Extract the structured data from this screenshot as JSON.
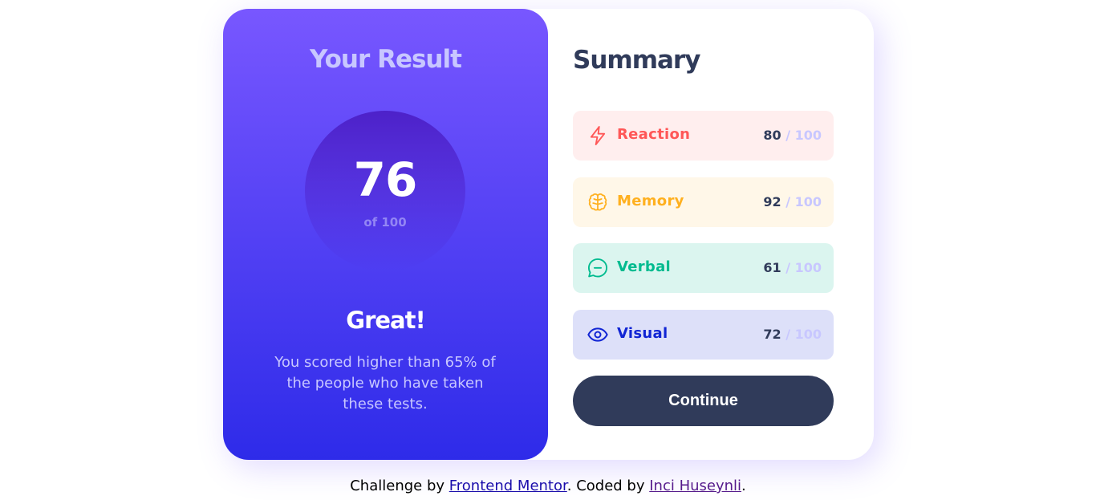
{
  "result": {
    "title": "Your Result",
    "score": "76",
    "score_of": "of 100",
    "rating": "Great!",
    "description": "You scored higher than 65% of the people who have taken these tests."
  },
  "summary": {
    "title": "Summary",
    "items": [
      {
        "label": "Reaction",
        "score": "80",
        "max": "/ 100",
        "icon": "lightning-icon",
        "color": "#ff5757"
      },
      {
        "label": "Memory",
        "score": "92",
        "max": "/ 100",
        "icon": "brain-icon",
        "color": "#ffb01f"
      },
      {
        "label": "Verbal",
        "score": "61",
        "max": "/ 100",
        "icon": "chat-bubble-icon",
        "color": "#00bb8f"
      },
      {
        "label": "Visual",
        "score": "72",
        "max": "/ 100",
        "icon": "eye-icon",
        "color": "#1125d4"
      }
    ],
    "continue_label": "Continue"
  },
  "attribution": {
    "prefix": "Challenge by ",
    "link1": "Frontend Mentor",
    "middle": ". Coded by ",
    "link2": "Inci Huseynli",
    "suffix": "."
  },
  "colors": {
    "gradient_start": "#7857ff",
    "gradient_end": "#2e2be9",
    "dark_navy": "#303b5a"
  }
}
